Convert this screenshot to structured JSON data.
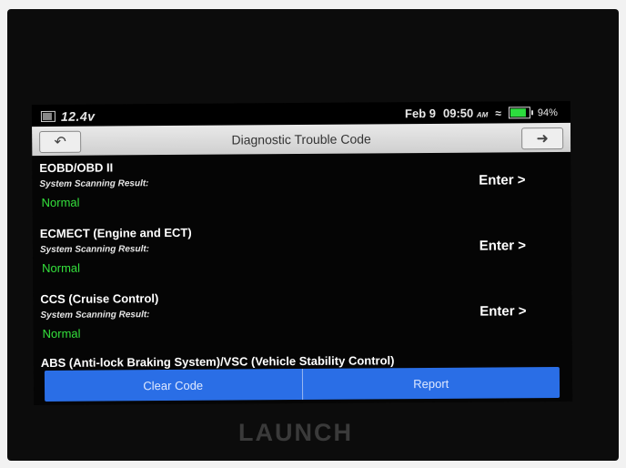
{
  "status_bar": {
    "voltage": "12.4v",
    "date": "Feb 9",
    "time": "09:50",
    "time_suffix": "AM",
    "battery_percent": "94%",
    "battery_level": 0.94,
    "battery_color": "#2ddc3e"
  },
  "header": {
    "title": "Diagnostic Trouble Code",
    "back_icon": "back-arrow-icon",
    "exit_icon": "exit-icon"
  },
  "items": [
    {
      "name": "EOBD/OBD II",
      "subtitle": "System Scanning Result:",
      "status": "Normal",
      "action": "Enter >"
    },
    {
      "name": "ECMECT (Engine and ECT)",
      "subtitle": "System Scanning Result:",
      "status": "Normal",
      "action": "Enter >"
    },
    {
      "name": "CCS (Cruise Control)",
      "subtitle": "System Scanning Result:",
      "status": "Normal",
      "action": "Enter >"
    },
    {
      "name": "ABS (Anti-lock Braking System)/VSC (Vehicle Stability Control)"
    }
  ],
  "bottom_bar": {
    "clear_label": "Clear Code",
    "report_label": "Report",
    "accent": "#2a6ee6"
  },
  "status_color": "#34e03c",
  "brand": "LAUNCH"
}
